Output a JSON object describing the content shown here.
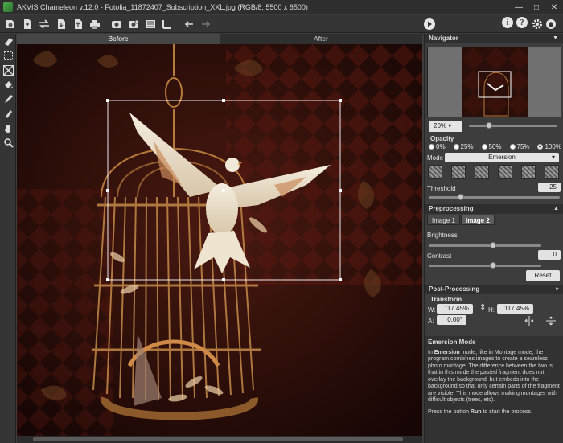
{
  "window": {
    "title": "AKVIS Chameleon v.12.0 - Fotolia_11872407_Subscription_XXL.jpg (RGB/8, 5500 x 6500)",
    "minimize": "—",
    "maximize": "□",
    "close": "✕"
  },
  "toolbar": {
    "icons": [
      "open-image-icon",
      "open-fragment-icon",
      "swap-icon",
      "save-icon",
      "export-icon",
      "print-icon",
      "share-icon",
      "adjust-icon",
      "settings-icon",
      "ruler-icon",
      "undo-icon",
      "redo-icon"
    ],
    "run_icon": "run-icon",
    "right": {
      "about": "i",
      "help": "?",
      "settings_icon": "gear-icon",
      "plugin_icon": "bug-icon"
    }
  },
  "left_tools": [
    "eraser-icon",
    "selection-icon",
    "transform-icon",
    "fill-icon",
    "pen-icon",
    "mop-icon",
    "hand-icon",
    "zoom-icon"
  ],
  "view_tabs": {
    "before": "Before",
    "after": "After"
  },
  "navigator": {
    "title": "Navigator",
    "zoom": "20%"
  },
  "settings": {
    "opacity_label": "Opacity",
    "opacity_options": [
      "0%",
      "25%",
      "50%",
      "75%",
      "100%"
    ],
    "opacity_selected": "100%",
    "mode_label": "Mode",
    "mode_value": "Emersion",
    "threshold_label": "Threshold",
    "threshold_value": "25",
    "threshold_fraction": 0.25
  },
  "preprocessing": {
    "title": "Preprocessing",
    "tabs": [
      "Image 1",
      "Image 2"
    ],
    "active_tab": "Image 2",
    "brightness_label": "Brightness",
    "brightness_value": "0",
    "contrast_label": "Contrast",
    "contrast_value": "0",
    "reset_label": "Reset"
  },
  "postprocessing": {
    "title": "Post-Processing"
  },
  "transform": {
    "title": "Transform",
    "w_label": "W:",
    "w_value": "117.45%",
    "h_label": "H:",
    "h_value": "117.45%",
    "a_label": "A:",
    "a_value": "0.00°"
  },
  "help": {
    "title": "Emersion Mode",
    "p1_pre": "In ",
    "p1_bold": "Emersion",
    "p1_post": " mode, like in Montage mode, the program combines images to create a seamless photo montage. The difference between the two is that in this mode the pasted fragment does not overlay the background, but embeds into the background so that only certain parts of the fragment are visible. This mode allows making montages with difficult objects (trees, etc).",
    "p2_pre": "Press the button ",
    "p2_bold": "Run",
    "p2_post": " to start the process."
  }
}
